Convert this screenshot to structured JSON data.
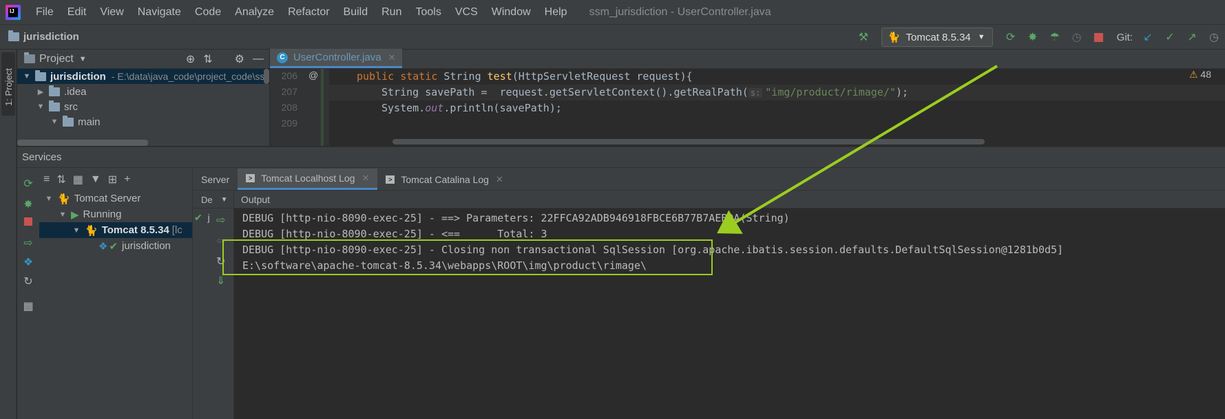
{
  "app": {
    "menu": [
      "File",
      "Edit",
      "View",
      "Navigate",
      "Code",
      "Analyze",
      "Refactor",
      "Build",
      "Run",
      "Tools",
      "VCS",
      "Window",
      "Help"
    ],
    "window_title": "ssm_jurisdiction - UserController.java"
  },
  "navbar": {
    "breadcrumb": "jurisdiction",
    "run_config": "Tomcat 8.5.34",
    "git_label": "Git:"
  },
  "left_strip": {
    "project_tab": "1: Project"
  },
  "project": {
    "title": "Project",
    "tree": [
      {
        "label": "jurisdiction",
        "suffix": "- E:\\data\\java_code\\project_code\\ssr"
      },
      {
        "label": ".idea"
      },
      {
        "label": "src"
      },
      {
        "label": "main"
      }
    ]
  },
  "editor": {
    "tab": "UserController.java",
    "warnings": "48",
    "lines": [
      {
        "no": "206"
      },
      {
        "no": "207",
        "hint": "s:"
      },
      {
        "no": "208"
      },
      {
        "no": "209"
      }
    ],
    "code": {
      "l206_kw": "public static",
      "l206_type": " String ",
      "l206_fn": "test",
      "l206_rest": "(HttpServletRequest request){",
      "l207_a": "String savePath =  request.getServletContext().getRealPath(",
      "l207_str": "\"img/product/rimage/\"",
      "l207_end": ");",
      "l208_a": "System.",
      "l208_field": "out",
      "l208_b": ".println(savePath);"
    }
  },
  "services": {
    "title": "Services",
    "tree": [
      {
        "label": "Tomcat Server"
      },
      {
        "label": "Running"
      },
      {
        "label": "Tomcat 8.5.34",
        "suffix": "[lc"
      },
      {
        "label": "jurisdiction"
      }
    ],
    "tabs": [
      "Server",
      "Tomcat Localhost Log",
      "Tomcat Catalina Log"
    ],
    "deploy_header": "De",
    "deploy_item": "j",
    "output_title": "Output",
    "log": [
      "DEBUG [http-nio-8090-exec-25] - ==> Parameters: 22FFCA92ADB946918FBCE6B77B7AEBDA(String)",
      "DEBUG [http-nio-8090-exec-25] - <==      Total: 3",
      "DEBUG [http-nio-8090-exec-25] - Closing non transactional SqlSession [org.apache.ibatis.session.defaults.DefaultSqlSession@1281b0d5]",
      "E:\\software\\apache-tomcat-8.5.34\\webapps\\ROOT\\img\\product\\rimage\\"
    ]
  },
  "colors": {
    "annotation": "#9acd1f",
    "accent": "#4a88c7"
  }
}
